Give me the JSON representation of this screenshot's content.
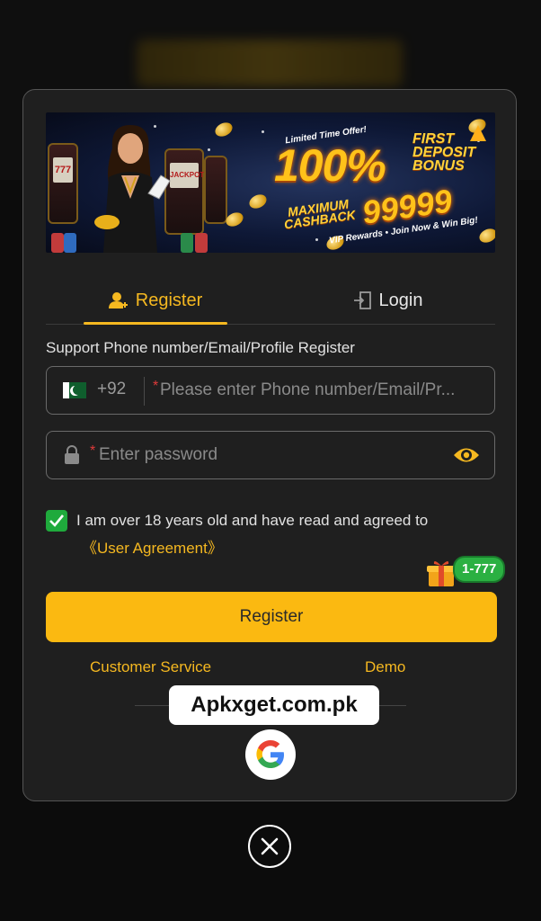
{
  "banner": {
    "limited": "Limited Time Offer!",
    "percent": "100%",
    "first_deposit": "FIRST DEPOSIT BONUS",
    "max_cashback": "MAXIMUM CASHBACK",
    "amount": "99999",
    "vip": "VIP Rewards • Join Now & Win Big!",
    "slot_text": "777",
    "jackpot": "JACKPOT"
  },
  "tabs": [
    {
      "label": "Register",
      "icon": "user-add-icon",
      "active": true
    },
    {
      "label": "Login",
      "icon": "login-door-icon",
      "active": false
    }
  ],
  "form": {
    "hint": "Support Phone number/Email/Profile Register",
    "country_code": "+92",
    "country_flag": "pakistan-flag",
    "phone_placeholder": "Please enter Phone number/Email/Pr...",
    "password_placeholder": "Enter password",
    "required_mark": "*"
  },
  "agreement": {
    "text": "I am over 18 years old and have read and agreed to",
    "link": "《User Agreement》",
    "checked": true
  },
  "promo_badge": "1-777",
  "register_button": "Register",
  "links": {
    "customer_service": "Customer Service",
    "demo": "Demo"
  },
  "watermark": "Apkxget.com.pk",
  "colors": {
    "accent": "#fbb911",
    "check": "#1faa3c",
    "badge": "#2bb042",
    "background": "#1f1f1f"
  }
}
